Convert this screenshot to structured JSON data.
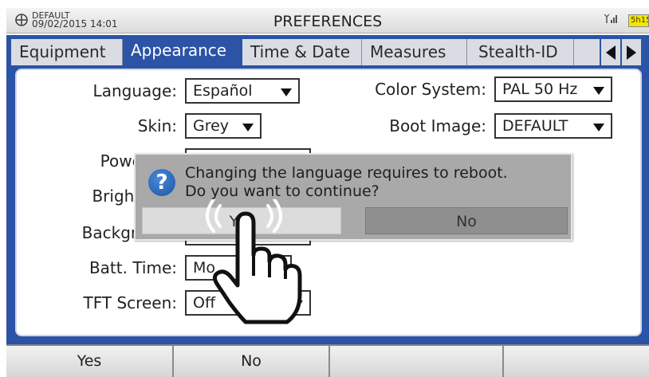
{
  "status": {
    "left_line1": "DEFAULT",
    "left_line2": "09/02/2015 14:01",
    "title": "PREFERENCES",
    "battery": "5h15"
  },
  "tabs": [
    {
      "label": "Equipment"
    },
    {
      "label": "Appearance"
    },
    {
      "label": "Time & Date"
    },
    {
      "label": "Measures"
    },
    {
      "label": "Stealth-ID"
    }
  ],
  "form": {
    "language": {
      "label": "Language:",
      "value": "Español"
    },
    "skin": {
      "label": "Skin:",
      "value": "Grey"
    },
    "power_off": {
      "label": "Power Off"
    },
    "brightness": {
      "label": "Brightness"
    },
    "background": {
      "label": "Background"
    },
    "batt_time": {
      "label": "Batt. Time:",
      "value": "Mo"
    },
    "tft_screen": {
      "label": "TFT Screen:",
      "value": "Off"
    },
    "color_system": {
      "label": "Color System:",
      "value": "PAL 50 Hz"
    },
    "boot_image": {
      "label": "Boot Image:",
      "value": "DEFAULT"
    }
  },
  "dialog": {
    "line1": "Changing the language requires to reboot.",
    "line2": "Do you want to continue?",
    "yes": "Yes",
    "no": "No",
    "icon": "question-icon"
  },
  "softkeys": [
    "Yes",
    "No",
    "",
    ""
  ],
  "colors": {
    "accent": "#2b53a6",
    "battery": "#f6e600"
  }
}
